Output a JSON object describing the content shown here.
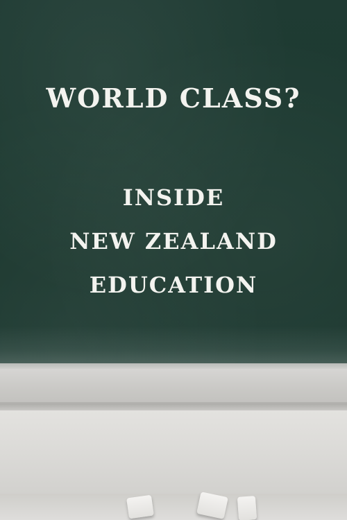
{
  "cover": {
    "title": "WORLD CLASS?",
    "subtitle_lines": [
      "INSIDE",
      "NEW ZEALAND",
      "EDUCATION"
    ]
  },
  "colors": {
    "chalkboard": "#1d3a31",
    "text": "#f3f3ef",
    "ledge": "#d6d5d3"
  },
  "illustration": {
    "chalkboard": "chalkboard-background",
    "ledge": "chalk-ledge",
    "chalk_pieces": "chalk-piece"
  }
}
